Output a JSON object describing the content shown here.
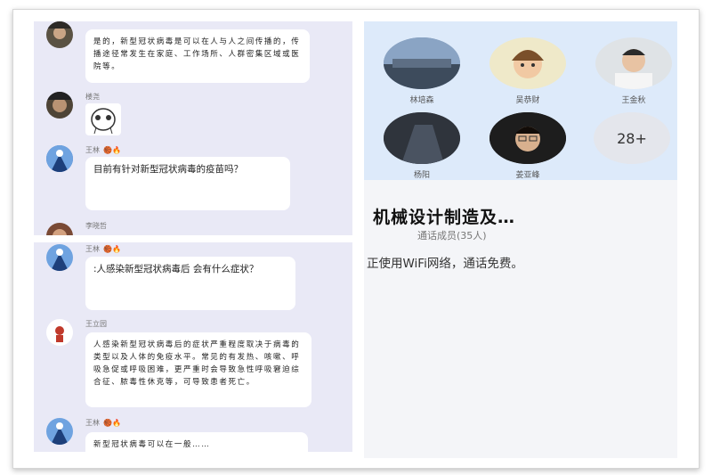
{
  "chat_top": {
    "msg1": {
      "sender": "楼尧",
      "text": "是的，新型冠状病毒是可以在人与人之间传播的，传播途径常发生在家庭、工作场所、人群密集区域或医院等。"
    },
    "msg2": {
      "sender": "楼尧",
      "sticker": "cartoon-face-sticker"
    },
    "msg3": {
      "sender": "王林",
      "text": "目前有针对新型冠状病毒的疫苗吗？"
    },
    "msg4": {
      "sender": "李晓哲"
    }
  },
  "chat_bottom": {
    "msg1": {
      "sender": "王林",
      "text": ":人感染新型冠状病毒后 会有什么症状？"
    },
    "msg2": {
      "sender": "王立园",
      "text": "人感染新型冠状病毒后的症状严重程度取决于病毒的类型以及人体的免疫水平。常见的有发热、咳嗽、呼吸急促或呼吸困难，更严重时会导致急性呼吸窘迫综合征、脓毒性休克等，可导致患者死亡。"
    },
    "msg3": {
      "sender": "王林",
      "text": "新型冠状病毒可以在一般……"
    }
  },
  "call_panel": {
    "members": [
      {
        "name": "林培森"
      },
      {
        "name": "吴恭财"
      },
      {
        "name": "王金秋"
      },
      {
        "name": "杨阳"
      },
      {
        "name": "姜亚峰"
      }
    ],
    "more_count": "28+",
    "group_title": "机械设计制造及…",
    "member_count_label": "通话成员(35人)",
    "network_notice": "正使用WiFi网络，通话免费。"
  },
  "colors": {
    "chat_bg": "#e9e9f6",
    "call_header_bg": "#ddeafa",
    "bubble": "#ffffff"
  }
}
